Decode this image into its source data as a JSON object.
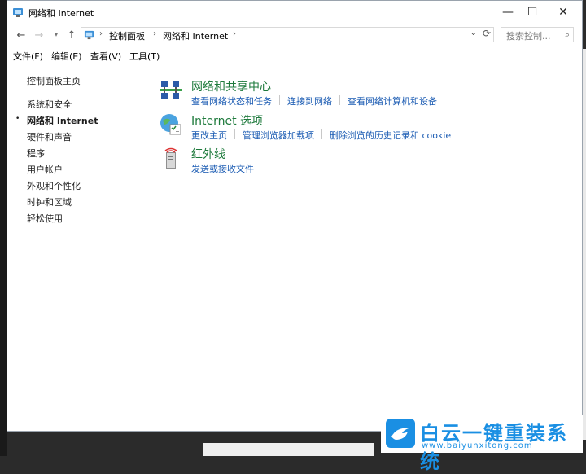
{
  "window": {
    "title": "网络和 Internet",
    "controls": {
      "minimize": "—",
      "maximize": "☐",
      "close": "✕"
    }
  },
  "navbar": {
    "back": "←",
    "forward": "→",
    "history": "▾",
    "up": "↑",
    "breadcrumbs": [
      "控制面板",
      "网络和 Internet"
    ],
    "separator": "›",
    "dropdown": "⌄",
    "refresh": "⟳",
    "search_placeholder": "搜索控制...",
    "search_icon": "⌕"
  },
  "menubar": {
    "items": [
      "文件(F)",
      "编辑(E)",
      "查看(V)",
      "工具(T)"
    ]
  },
  "sidebar": {
    "home": "控制面板主页",
    "items": [
      {
        "label": "系统和安全",
        "current": false
      },
      {
        "label": "网络和 Internet",
        "current": true
      },
      {
        "label": "硬件和声音",
        "current": false
      },
      {
        "label": "程序",
        "current": false
      },
      {
        "label": "用户帐户",
        "current": false
      },
      {
        "label": "外观和个性化",
        "current": false
      },
      {
        "label": "时钟和区域",
        "current": false
      },
      {
        "label": "轻松使用",
        "current": false
      }
    ],
    "bullet": "•"
  },
  "categories": [
    {
      "title": "网络和共享中心",
      "icon": "network-sharing-icon",
      "links": [
        "查看网络状态和任务",
        "连接到网络",
        "查看网络计算机和设备"
      ]
    },
    {
      "title": "Internet 选项",
      "icon": "internet-options-icon",
      "links": [
        "更改主页",
        "管理浏览器加载项",
        "删除浏览的历史记录和 cookie"
      ]
    },
    {
      "title": "红外线",
      "icon": "infrared-icon",
      "links": [
        "发送或接收文件"
      ]
    }
  ],
  "watermark": {
    "text": "白云一键重装系统",
    "url": "www.baiyunxitong.com"
  },
  "colors": {
    "link": "#1c5cb3",
    "category_title": "#1e7a3c",
    "brand": "#1a8fe3"
  }
}
